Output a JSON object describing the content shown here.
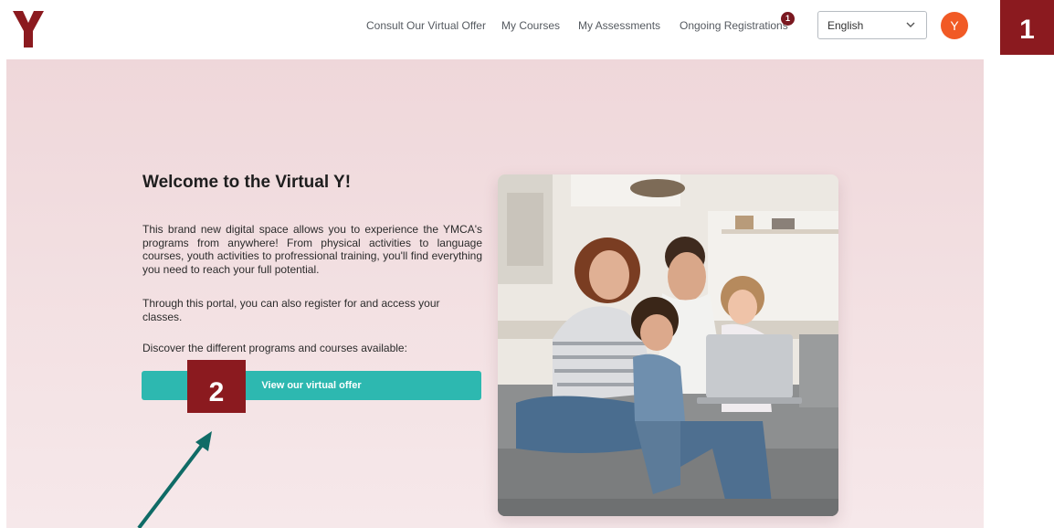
{
  "header": {
    "logo": "ymca-y-logo",
    "nav": [
      {
        "label": "Consult Our Virtual Offer"
      },
      {
        "label": "My Courses"
      },
      {
        "label": "My Assessments"
      },
      {
        "label": "Ongoing Registrations",
        "badge": "1"
      }
    ],
    "language": {
      "selected": "English",
      "icon": "chevron-down-icon"
    },
    "avatar": {
      "initial": "Y",
      "color": "#f15a25"
    }
  },
  "hero": {
    "title": "Welcome to the Virtual Y!",
    "paragraphs": [
      "This brand new digital space allows you to experience the YMCA's programs from anywhere! From physical activities to language courses, youth activities to profressional training, you'll find everything you need to reach your full potential.",
      "Through this portal, you can also register for and access your classes.",
      "Discover the different programs and courses available:"
    ],
    "cta_label": "View our virtual offer",
    "image": "family-with-laptop-photo"
  },
  "annotations": {
    "callouts": [
      "1",
      "2"
    ],
    "arrow": "arrow-pointing-to-button"
  },
  "colors": {
    "brand_red": "#8b1a1f",
    "accent_teal": "#2db8b0",
    "badge": "#7a1820",
    "arrow": "#0f6b66",
    "hero_background": "#efd7da"
  }
}
